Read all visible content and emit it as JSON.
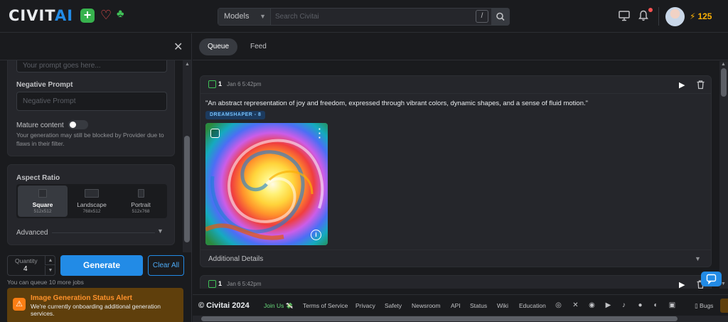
{
  "header": {
    "logo_text": "CIVIT",
    "logo_accent": "AI",
    "search": {
      "category": "Models",
      "placeholder": "Search Civitai",
      "shortcut": "/"
    },
    "buzz": "125"
  },
  "generator": {
    "prompt_placeholder": "Your prompt goes here...",
    "negative_label": "Negative Prompt",
    "negative_placeholder": "Negative Prompt",
    "mature_label": "Mature content",
    "mature_note": "Your generation may still be blocked by Provider due to flaws in their filter.",
    "aspect_label": "Aspect Ratio",
    "aspect_options": [
      {
        "name": "Square",
        "dims": "512x512"
      },
      {
        "name": "Landscape",
        "dims": "768x512"
      },
      {
        "name": "Portrait",
        "dims": "512x768"
      }
    ],
    "advanced_label": "Advanced",
    "quantity_label": "Quantity",
    "quantity_value": "4",
    "generate_label": "Generate",
    "clear_label": "Clear All",
    "queue_note": "You can queue 10 more jobs",
    "alert_title": "Image Generation Status Alert",
    "alert_text": "We're currently onboarding additional generation services."
  },
  "main": {
    "tabs": [
      "Queue",
      "Feed"
    ],
    "jobs": [
      {
        "count": "1",
        "date": "Jan 6 5:42pm",
        "prompt": "\"An abstract representation of joy and freedom, expressed through vibrant colors, dynamic shapes, and a sense of fluid motion.\"",
        "model": "DREAMSHAPER - 8",
        "details_label": "Additional Details"
      },
      {
        "count": "1",
        "date": "Jan 6 5:42pm"
      }
    ]
  },
  "footer": {
    "copyright": "© Civitai 2024",
    "links": [
      "Join Us 💸",
      "Terms of Service",
      "Privacy",
      "Safety",
      "Newsroom",
      "API",
      "Status",
      "Wiki",
      "Education"
    ],
    "social_icons": [
      "discord-icon",
      "x-icon",
      "instagram-icon",
      "youtube-icon",
      "tiktok-icon",
      "reddit-icon",
      "github-icon",
      "twitch-icon"
    ],
    "bugs": "Bugs"
  },
  "colors": {
    "accent": "#228be6",
    "green": "#40c057",
    "alert_bg": "#5f3f0c"
  }
}
